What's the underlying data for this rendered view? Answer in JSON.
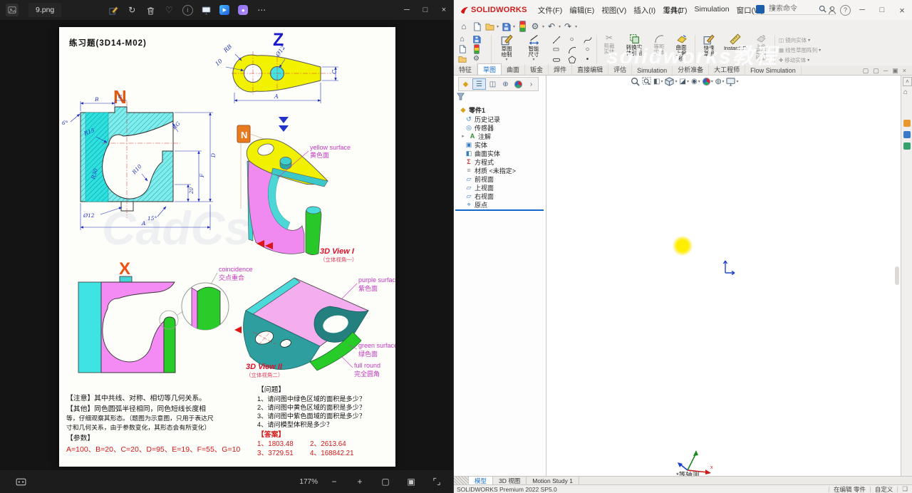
{
  "photos": {
    "app_title": "9.png",
    "zoom_level": "177%"
  },
  "sheet": {
    "title": "练习题(3D14-M02)",
    "watermark": "CadCs",
    "z_view": {
      "label": "Z",
      "dim_rb": "RB",
      "dim_10": "10",
      "dim_d12": "Ø12",
      "dim_a": "A",
      "dim_c": "C"
    },
    "n_view": {
      "label": "N",
      "dim_6": "6°",
      "dim_b": "B",
      "dim_g": "G",
      "dim_r15": "R15",
      "dim_r30": "R30",
      "dim_r10": "R10",
      "dim_rg": "RG",
      "dim_d12": "Ø12",
      "dim_15": "15°",
      "dim_20": "20",
      "dim_f": "F",
      "dim_d": "D",
      "dim_a": "A"
    },
    "iso1": {
      "tag": "N",
      "arrow": "Z",
      "title": "3D View I",
      "subtitle": "（立体视角一）",
      "label_en": "yellow surface",
      "label_zh": "黄色面"
    },
    "x_view": {
      "label": "X",
      "callout_en": "coincidence",
      "callout_zh": "交点重合"
    },
    "iso2": {
      "title": "3D View II",
      "subtitle": "（立体视角二）",
      "purple_en": "purple surface",
      "purple_zh": "紫色面",
      "green_en": "green surface",
      "green_zh": "绿色面",
      "round_en": "full round",
      "round_zh": "完全圆角"
    },
    "note1": "【注意】其中共线、对称、相切等几何关系。",
    "note2": "【其他】同色圆弧半径相同，同色短线长度相",
    "note3": "等，仔细观察其形态。（题图为示意图，只用于表达尺",
    "note4": "寸和几何关系，由于参数变化，其形态会有所变化）",
    "params_label": "【参数】",
    "params": "A=100、B=20、C=20、D=95、E=19、F=55、G=10",
    "q_label": "【问题】",
    "q1": "1、请问图中绿色区域的面积是多少？",
    "q2": "2、请问图中黄色区域的面积是多少？",
    "q3": "3、请问图中紫色面域的面积是多少？",
    "q4": "4、请问模型体积是多少？",
    "ans_label": "【答案】",
    "ans1": "1、1803.48",
    "ans2": "2、2613.64",
    "ans3": "3、3729.51",
    "ans4": "4、168842.21"
  },
  "sw": {
    "logo": "SOLIDWORKS",
    "menu": [
      "文件(F)",
      "编辑(E)",
      "视图(V)",
      "插入(I)",
      "工具(T)",
      "Simulation",
      "窗口(W)"
    ],
    "doc_title": "零件1",
    "search_placeholder": "搜索命令",
    "watermark": "solidworks教程",
    "ribbon": {
      "sketch": "草图\n绘制",
      "smart_dim": "智能\n尺寸",
      "trim": "剪裁\n实体",
      "convert": "转换实\n体引用",
      "offset": "等距\n实体",
      "surf_offset": "曲面\n上偏\n移",
      "quick_sketch": "快速\n草图",
      "instant2d": "Instant2D",
      "shaded": "上色\n草图\n轮廓",
      "mirror": "镜向实体",
      "pattern": "线性草图阵列",
      "move": "移动实体"
    },
    "tabs": [
      "特征",
      "草图",
      "曲面",
      "钣金",
      "焊件",
      "直接编辑",
      "评估",
      "Simulation",
      "分析准备",
      "大工程师",
      "Flow Simulation"
    ],
    "tree_root": "零件1",
    "tree": [
      "历史记录",
      "传感器",
      "注解",
      "实体",
      "曲面实体",
      "方程式",
      "材质 <未指定>",
      "前视面",
      "上视面",
      "右视面",
      "原点"
    ],
    "view_label": "*等轴测",
    "doc_tabs": [
      "模型",
      "3D 视图",
      "Motion Study 1"
    ],
    "status": {
      "left": "SOLIDWORKS Premium 2022 SP5.0",
      "editing": "在编辑 零件",
      "custom": "自定义"
    }
  },
  "icons": {
    "home": "⌂",
    "gear": "⚙",
    "undo": "↶",
    "redo": "↷",
    "heart": "♡",
    "more": "⋯",
    "min": "─",
    "max": "□",
    "close": "×",
    "rotate": "↻",
    "sigma": "Σ",
    "origin": "⌖",
    "plane": "▱",
    "history": "↺",
    "sensor": "◎",
    "solid": "▣",
    "surface": "◧",
    "material": "≡",
    "annot": "A",
    "caret": "▾",
    "chev_right": "›",
    "chev_up": "˄",
    "pin": "✦",
    "info": "i",
    "section": "◧",
    "dispstyle": "◪",
    "eye": "◉",
    "scene": "◍",
    "clip": "❏",
    "zoom_out": "−",
    "zoom_in": "+",
    "fit": "▢",
    "actual": "▣",
    "fullscreen": "⌜⌟",
    "mirror": "◫",
    "pattern": "▦",
    "move": "✚",
    "scissors": "✂",
    "circle": "○",
    "rect": "▭",
    "cdot": "⊙",
    "point": "•",
    "expand": "▸",
    "filter_tree": "☰",
    "fmgr": "◆",
    "cfg": "◫",
    "dimx": "⊕",
    "play": "▶",
    "dot": "●"
  }
}
